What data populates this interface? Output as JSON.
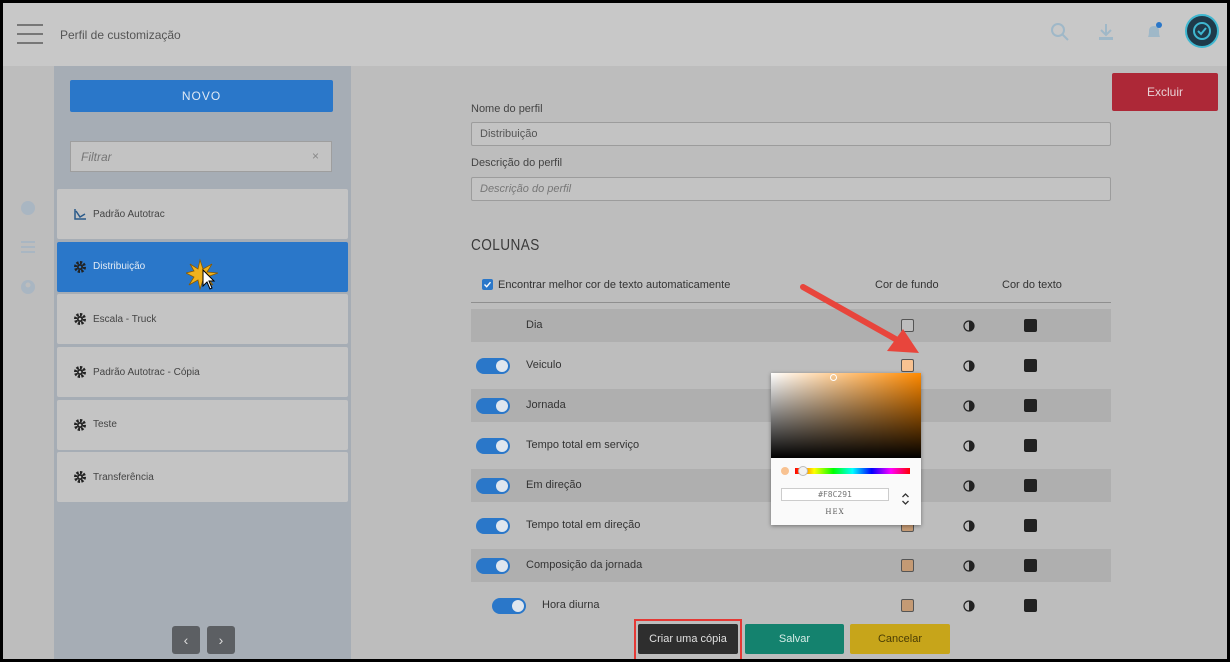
{
  "header": {
    "title": "Perfil de customização"
  },
  "sidebar": {
    "new_button": "NOVO",
    "filter_placeholder": "Filtrar",
    "filter_clear": "×",
    "items": [
      {
        "label": "Padrão Autotrac",
        "icon": "autotrac-logo-icon"
      },
      {
        "label": "Distribuição",
        "icon": "gear-icon",
        "selected": true
      },
      {
        "label": "Escala - Truck",
        "icon": "gear-icon"
      },
      {
        "label": "Padrão Autotrac - Cópia",
        "icon": "gear-icon"
      },
      {
        "label": "Teste",
        "icon": "gear-icon"
      },
      {
        "label": "Transferência",
        "icon": "gear-icon"
      }
    ],
    "prev": "‹",
    "next": "›"
  },
  "form": {
    "delete_button": "Excluir",
    "name_label": "Nome do perfil",
    "name_value": "Distribuição",
    "desc_label": "Descrição do perfil",
    "desc_placeholder": "Descrição do perfil",
    "columns_title": "COLUNAS",
    "auto_color_label": "Encontrar melhor cor de texto automaticamente",
    "bg_color_header": "Cor de fundo",
    "text_color_header": "Cor do texto"
  },
  "columns": [
    {
      "label": "Dia",
      "bg": "#bdbdbd"
    },
    {
      "label": "Veiculo",
      "bg": "#f8c291"
    },
    {
      "label": "Jornada",
      "bg": "#c49a74"
    },
    {
      "label": "Tempo total em serviço",
      "bg": "#c49a74"
    },
    {
      "label": "Em direção",
      "bg": "#c49a74"
    },
    {
      "label": "Tempo total em direção",
      "bg": "#c49a74"
    },
    {
      "label": "Composição da jornada",
      "bg": "#c49a74"
    },
    {
      "label": "Hora diurna",
      "bg": "#c49a74"
    }
  ],
  "color_picker": {
    "hex_value": "#F8C291",
    "mode": "HEX",
    "toggle": "⌃⌄"
  },
  "actions": {
    "copy": "Criar uma cópia",
    "save": "Salvar",
    "cancel": "Cancelar"
  },
  "colors": {
    "primary": "#2a77c9",
    "danger": "#ad2837",
    "success": "#14826e",
    "warning": "#c7a51a",
    "highlight": "#e53935",
    "arrow": "#e8453c"
  }
}
